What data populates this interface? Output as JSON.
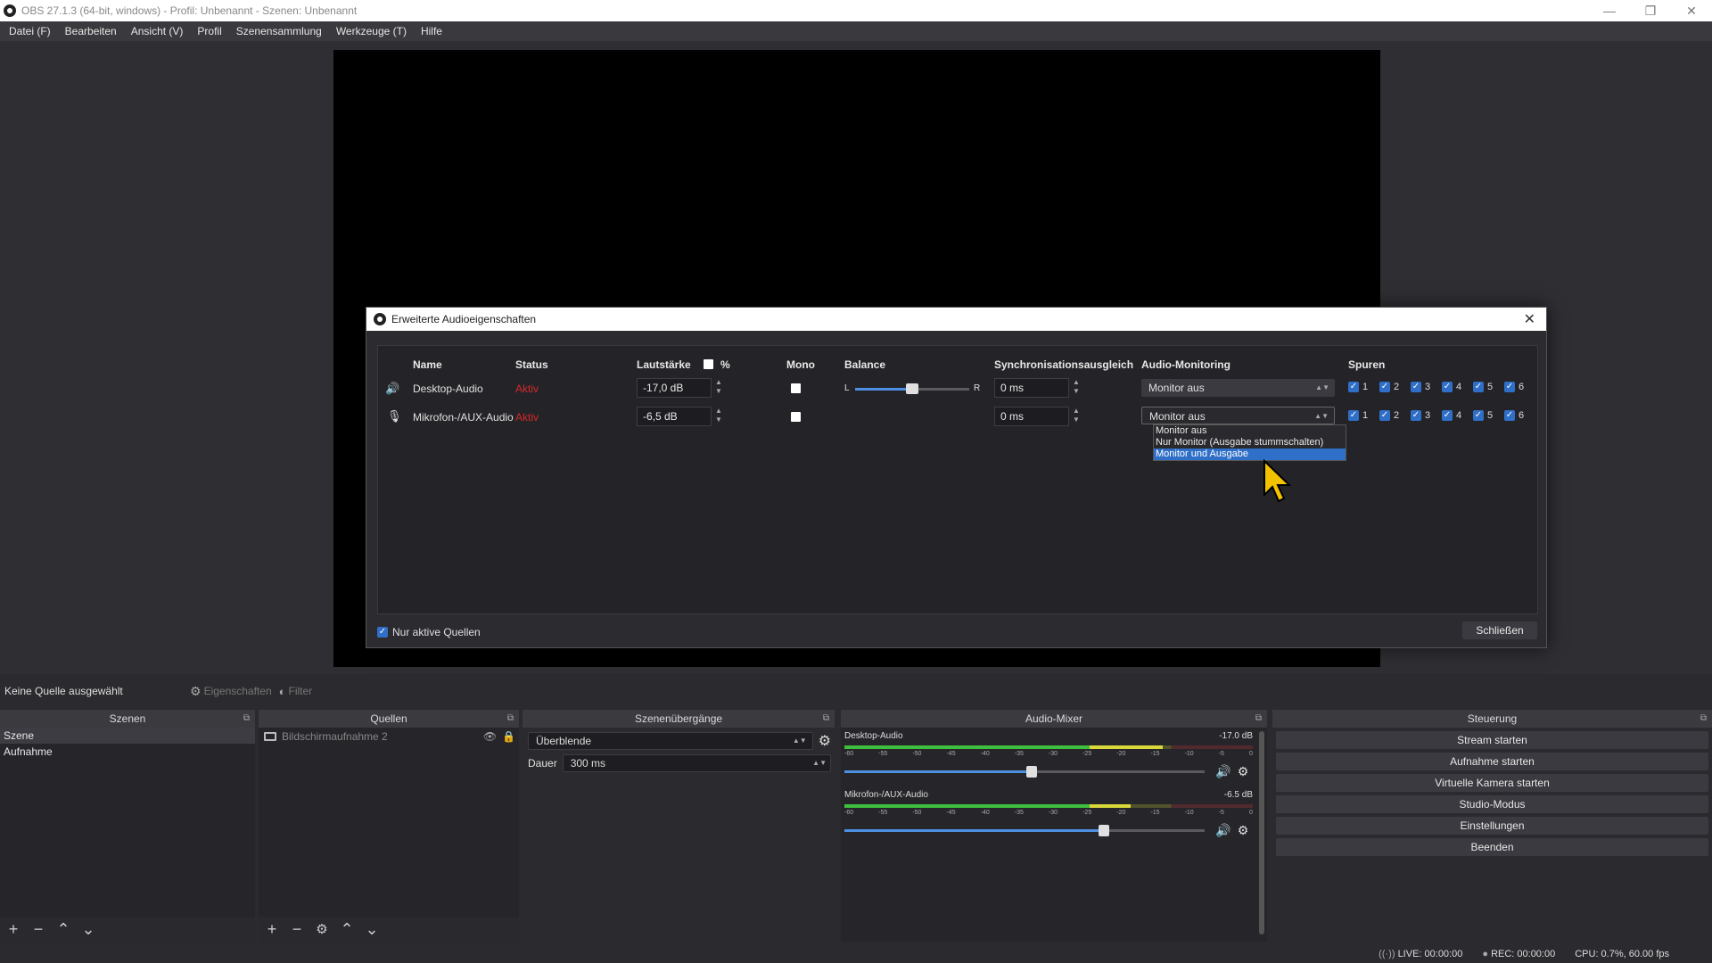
{
  "window": {
    "title": "OBS 27.1.3 (64-bit, windows) - Profil: Unbenannt - Szenen: Unbenannt",
    "minimize": "—",
    "maximize": "❐",
    "close": "✕"
  },
  "menu": [
    "Datei (F)",
    "Bearbeiten",
    "Ansicht (V)",
    "Profil",
    "Szenensammlung",
    "Werkzeuge (T)",
    "Hilfe"
  ],
  "source_toolbar": {
    "no_source": "Keine Quelle ausgewählt",
    "properties": "Eigenschaften",
    "filters": "Filter"
  },
  "scenes": {
    "title": "Szenen",
    "items": [
      "Szene",
      "Aufnahme"
    ]
  },
  "sources": {
    "title": "Quellen",
    "items": [
      "Bildschirmaufnahme 2"
    ]
  },
  "transitions": {
    "title": "Szenenübergänge",
    "selected": "Überblende",
    "duration_label": "Dauer",
    "duration_value": "300 ms"
  },
  "mixer": {
    "title": "Audio-Mixer",
    "channels": [
      {
        "name": "Desktop-Audio",
        "db": "-17.0 dB",
        "level": 0.78,
        "volume": 0.52
      },
      {
        "name": "Mikrofon-/AUX-Audio",
        "db": "-6.5 dB",
        "level": 0.7,
        "volume": 0.72
      }
    ],
    "scale": [
      "-60",
      "-55",
      "-50",
      "-45",
      "-40",
      "-35",
      "-30",
      "-25",
      "-20",
      "-15",
      "-10",
      "-5",
      "0"
    ]
  },
  "controls": {
    "title": "Steuerung",
    "buttons": [
      "Stream starten",
      "Aufnahme starten",
      "Virtuelle Kamera starten",
      "Studio-Modus",
      "Einstellungen",
      "Beenden"
    ]
  },
  "status": {
    "live": "LIVE: 00:00:00",
    "rec": "REC: 00:00:00",
    "cpu": "CPU: 0.7%, 60.00 fps"
  },
  "dialog": {
    "title": "Erweiterte Audioeigenschaften",
    "headers": {
      "name": "Name",
      "status": "Status",
      "volume": "Lautstärke",
      "percent": "%",
      "mono": "Mono",
      "balance": "Balance",
      "sync": "Synchronisationsausgleich",
      "monitoring": "Audio-Monitoring",
      "tracks": "Spuren"
    },
    "rows": [
      {
        "name": "Desktop-Audio",
        "status": "Aktiv",
        "volume": "-17,0 dB",
        "sync": "0 ms",
        "monitoring": "Monitor aus",
        "balance": 0.5
      },
      {
        "name": "Mikrofon-/AUX-Audio",
        "status": "Aktiv",
        "volume": "-6,5 dB",
        "sync": "0 ms",
        "monitoring": "Monitor aus"
      }
    ],
    "balance_left": "L",
    "balance_right": "R",
    "tracks": [
      "1",
      "2",
      "3",
      "4",
      "5",
      "6"
    ],
    "dropdown_options": [
      "Monitor aus",
      "Nur Monitor (Ausgabe stummschalten)",
      "Monitor und Ausgabe"
    ],
    "only_active": "Nur aktive Quellen",
    "close_button": "Schließen"
  }
}
